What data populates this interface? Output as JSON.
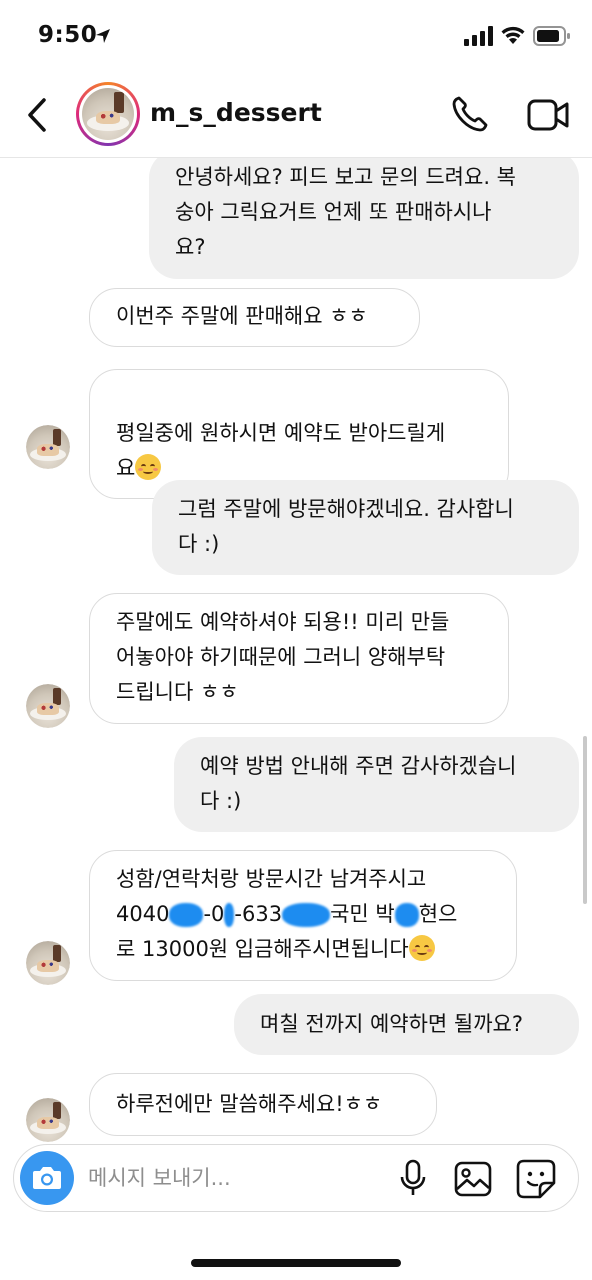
{
  "status_bar": {
    "time": "9:50"
  },
  "header": {
    "username": "m_s_dessert"
  },
  "messages": [
    {
      "direction": "out",
      "text": "안녕하세요? 피드 보고 문의 드려요. 복\n숭아 그릭요거트 언제 또 판매하시나\n요?"
    },
    {
      "direction": "in",
      "text": "이번주 주말에 판매해요 ㅎㅎ"
    },
    {
      "direction": "in",
      "text": "평일중에 원하시면 예약도 받아드릴게\n요",
      "emoji": "smiling-face-icon"
    },
    {
      "direction": "out",
      "text": "그럼 주말에 방문해야겠네요. 감사합니\n다 :)"
    },
    {
      "direction": "in",
      "text": "주말에도 예약하셔야 되용!! 미리 만들\n어놓아야 하기때문에 그러니 양해부탁\n드립니다 ㅎㅎ"
    },
    {
      "direction": "out",
      "text": "예약 방법 안내해 주면 감사하겠습니\n다 :)"
    },
    {
      "direction": "in",
      "line1": "성함/연락처랑 방문시간 남겨주시고",
      "line2_parts": [
        "4040",
        "-0",
        "-633",
        "국민 박",
        "현으"
      ],
      "line3": "로 13000원 입금해주시면됩니다",
      "emoji": "smiling-face-icon",
      "redaction_color": "#1d8cf0"
    },
    {
      "direction": "out",
      "text": "며칠 전까지 예약하면 될까요?"
    },
    {
      "direction": "in",
      "text": "하루전에만 말씀해주세요!ㅎㅎ"
    }
  ],
  "composer": {
    "placeholder": "메시지 보내기..."
  },
  "colors": {
    "outgoing_bubble": "#efefef",
    "incoming_border": "#dbdbdb",
    "camera_button": "#3897f0"
  }
}
